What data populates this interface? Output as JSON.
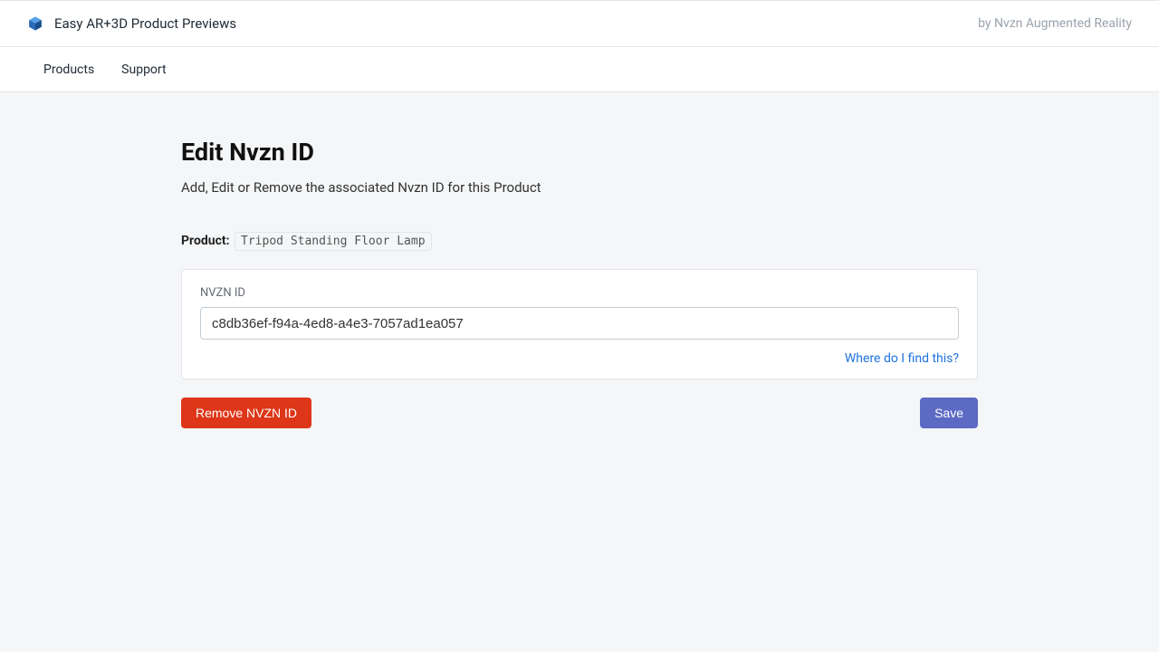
{
  "header": {
    "app_title": "Easy AR+3D Product Previews",
    "by_line": "by Nvzn Augmented Reality"
  },
  "nav": {
    "items": [
      "Products",
      "Support"
    ]
  },
  "page": {
    "title": "Edit Nvzn ID",
    "subtitle": "Add, Edit or Remove the associated Nvzn ID for this Product",
    "product_label": "Product:",
    "product_name": "Tripod Standing Floor Lamp"
  },
  "form": {
    "field_label": "NVZN ID",
    "field_value": "c8db36ef-f94a-4ed8-a4e3-7057ad1ea057",
    "help_link": "Where do I find this?"
  },
  "actions": {
    "remove_label": "Remove NVZN ID",
    "save_label": "Save"
  },
  "icons": {
    "app_icon": "cube-icon"
  },
  "colors": {
    "danger": "#de3618",
    "primary": "#5c6ac4",
    "link": "#1f73e0",
    "bg": "#f4f6f8"
  }
}
